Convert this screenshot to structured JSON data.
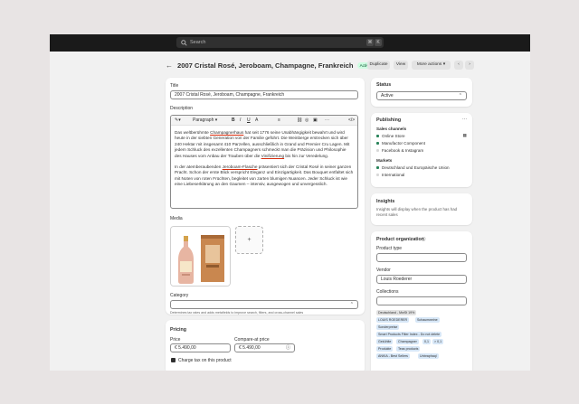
{
  "search": {
    "placeholder": "Search",
    "shortcut_1": "⌘",
    "shortcut_2": "K"
  },
  "header": {
    "title": "2007 Cristal Rosé, Jeroboam, Champagne, Frankreich",
    "status": "Active",
    "duplicate": "Duplicate",
    "view": "View",
    "more_actions": "More actions",
    "prev": "‹",
    "next": "›"
  },
  "product": {
    "title_label": "Title",
    "title_value": "2007 Cristal Rosé, Jeroboam, Champagne, Frankreich",
    "description_label": "Description",
    "toolbar": {
      "paragraph": "Paragraph",
      "bold": "B",
      "italic": "I",
      "underline": "U",
      "color": "A",
      "align": "≡",
      "more": "···",
      "code": "</>"
    },
    "desc_p1_a": "Das weltberühmte ",
    "desc_p1_link": "Champagnerhaus",
    "desc_p1_b": " hat seit 1776 seine Unabhängigkeit bewahrt und wird heute in der siebten Generation von der Familie geführt. Die Weinberge erstrecken sich über 240 Hektar mit insgesamt 410 Parzellen, ausschließlich in Grand und Premier Cru Lagen. Mit jedem Schluck des exzellenten Champagners schmeckt man die Präzision und Philosophie des Hauses vom Anbau der Trauben über die ",
    "desc_p1_link2": "Vinifizierung",
    "desc_p1_c": " bis hin zur Veredelung.",
    "desc_p2_a": "In der atemberaubenden ",
    "desc_p2_link": "Jeroboam-Flasche",
    "desc_p2_b": " präsentiert sich der Cristal Rosé in seiner ganzen Pracht. Schon der erste Blick verspricht Eleganz und Einzigartigkeit. Das Bouquet entfaltet sich mit Noten von roten Früchten, begleitet von zarten blumigen Nuancen. Jeder Schluck ist wie eine Liebeserklärung an den Gaumen – intensiv, ausgewogen und unvergesslich.",
    "media_label": "Media",
    "media_add": "+",
    "category_label": "Category",
    "category_help": "Determines tax rates and adds metafields to improve search, filters, and cross-channel sales"
  },
  "pricing": {
    "title": "Pricing",
    "price_label": "Price",
    "price_value": "€ 5.490,00",
    "compare_label": "Compare-at price",
    "compare_value": "€ 5.490,00",
    "tax_label": "Charge tax on this product"
  },
  "status_card": {
    "title": "Status",
    "value": "Active"
  },
  "publishing": {
    "title": "Publishing",
    "channels_label": "Sales channels",
    "channels": [
      "Online Store",
      "Manufactor Component",
      "Facebook & Instagram"
    ],
    "markets_label": "Markets",
    "markets": [
      "Deutschland und Europäische Union",
      "International"
    ]
  },
  "insights": {
    "title": "Insights",
    "text": "Insights will display when the product has had recent sales"
  },
  "organization": {
    "title": "Product organization",
    "type_label": "Product type",
    "vendor_label": "Vendor",
    "vendor_value": "Louis Roederer",
    "collections_label": "Collections",
    "tags": [
      "Deutschland - MwSt 19%",
      "LOUIS ROEDERER",
      "Schaumweine",
      "Sonderpreise",
      "Smart Products Filter Index - Do not delete",
      "Gekühlte",
      "Champagner",
      "0,1",
      "> 0,1",
      "Produkte",
      "Teas products",
      "ANKIA - Best Sellers",
      "Unbraphaql"
    ]
  },
  "colors": {
    "accent": "#303030",
    "badge_bg": "#cdfee1",
    "link": "#005bd3",
    "topbar": "#1a1a1a"
  }
}
